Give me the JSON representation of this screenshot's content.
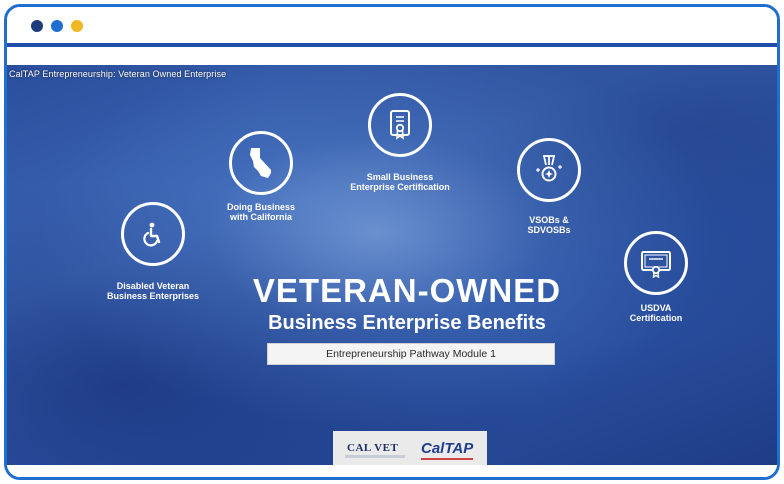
{
  "window": {
    "dots": [
      "#1d3d7a",
      "#1f6fd1",
      "#f2b824"
    ]
  },
  "video": {
    "title": "CalTAP Entrepreneurship: Veteran Owned Enterprise",
    "main_title": "VETERAN-OWNED",
    "sub_title": "Business Enterprise Benefits",
    "module": "Entrepreneurship Pathway Module 1",
    "items": [
      {
        "label_line1": "Disabled Veteran",
        "label_line2": "Business Enterprises",
        "icon": "wheelchair-icon"
      },
      {
        "label_line1": "Doing Business",
        "label_line2": "with California",
        "icon": "california-map-icon"
      },
      {
        "label_line1": "Small Business",
        "label_line2": "Enterprise Certification",
        "icon": "certificate-icon"
      },
      {
        "label_line1": "VSOBs &",
        "label_line2": "SDVOSBs",
        "icon": "medal-icon"
      },
      {
        "label_line1": "USDVA",
        "label_line2": "Certification",
        "icon": "diploma-icon"
      }
    ],
    "logos": {
      "calvet": "CAL VET",
      "caltap": "CalTAP"
    }
  },
  "colors": {
    "frame": "#1f6fd1",
    "accent_bar": "#1f4ea8"
  }
}
